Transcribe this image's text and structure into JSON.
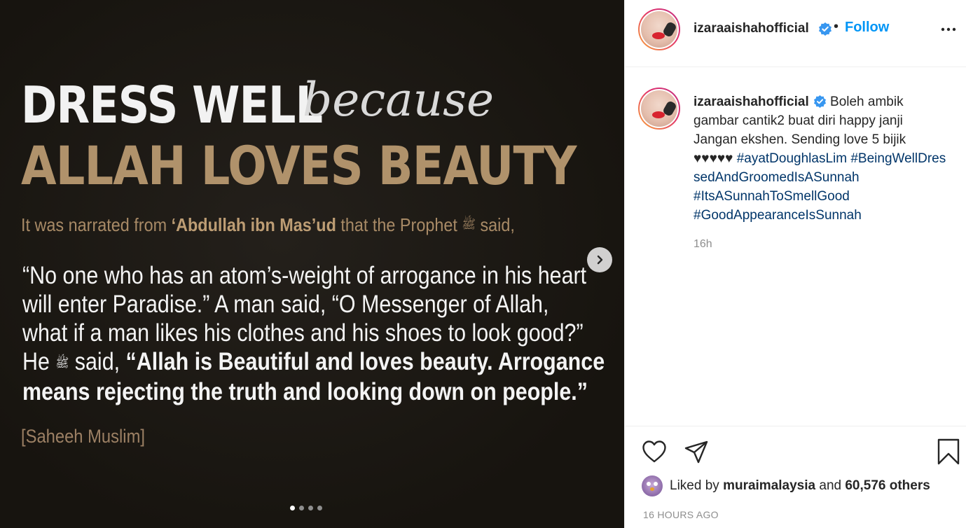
{
  "slide": {
    "heading_main": "DRESS WELL",
    "heading_script": "because",
    "heading_sub": "ALLAH LOVES BEAUTY",
    "narration_pre": "It was narrated from ",
    "narration_name": "‘Abdullah ibn Mas’ud",
    "narration_post_a": " that the Prophet ",
    "salawat": "ﷺ",
    "narration_post_b": " said,",
    "quote_l1": "“No one who has an atom’s-weight of arrogance in his heart",
    "quote_l2": "will enter Paradise.” A man said, “O Messenger of Allah,",
    "quote_l3": "what if a man likes his clothes and his shoes to look good?”",
    "quote_l4_pre": "He ",
    "quote_l4_mid": " said, ",
    "quote_l4_bold": "“Allah is Beautiful and loves beauty. Arrogance",
    "quote_l5_bold": "means rejecting the truth and looking down on people.”",
    "source": "[Saheeh Muslim]"
  },
  "carousel": {
    "current": 1,
    "total": 4
  },
  "header": {
    "username": "izaraaishahofficial",
    "separator": "•",
    "follow_label": "Follow"
  },
  "caption": {
    "username": "izaraaishahofficial",
    "text": "Boleh ambik gambar cantik2 buat diri happy janji Jangan ekshen. Sending love 5 bijik ♥♥♥♥♥",
    "tags": [
      "#ayatDoughlasLim",
      "#BeingWellDressedAndGroomedIsASunnah",
      "#ItsASunnahToSmellGood",
      "#GoodAppearanceIsSunnah"
    ],
    "time": "16h"
  },
  "likes": {
    "prefix": "Liked by",
    "user": "muraimalaysia",
    "and": "and",
    "others": "60,576 others"
  },
  "date": "16 HOURS AGO",
  "colors": {
    "accent": "#0095f6",
    "verified": "#3897f0",
    "heading_gold": "#b0926b"
  },
  "icons": [
    "verified-badge-icon",
    "more-options-icon",
    "next-arrow-icon",
    "heart-icon",
    "share-icon",
    "bookmark-icon"
  ]
}
